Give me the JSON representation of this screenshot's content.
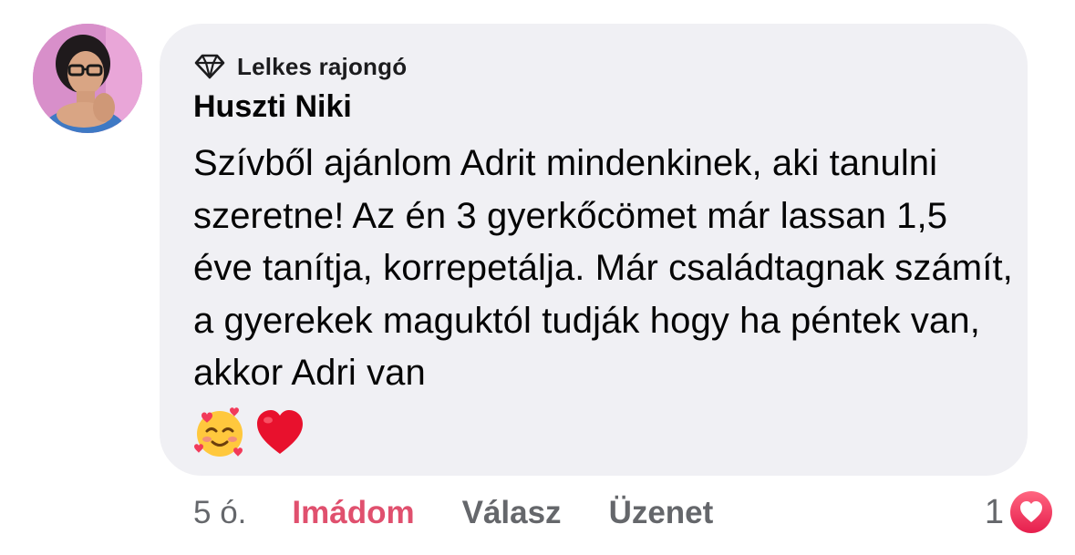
{
  "comment": {
    "badge": "Lelkes rajongó",
    "author": "Huszti Niki",
    "text": "Szívből ajánlom Adrit mindenkinek, aki tanulni szeretne! Az én 3 gyerkőcömet már lassan 1,5 éve tanítja, korrepetálja. Már családtagnak számít, a gyerekek maguktól tudják hogy ha péntek van, akkor Adri van",
    "emojis": [
      "smiling-face-with-hearts",
      "red-heart"
    ]
  },
  "actions": {
    "time": "5 ó.",
    "love_label": "Imádom",
    "reply_label": "Válasz",
    "message_label": "Üzenet"
  },
  "reactions": {
    "count": "1",
    "type": "love"
  },
  "icons": {
    "badge_icon": "diamond-icon",
    "reaction_icon": "love-reaction-icon"
  },
  "colors": {
    "bubble": "#f0f0f4",
    "love": "#e0506e",
    "secondary_text": "#65676b"
  }
}
